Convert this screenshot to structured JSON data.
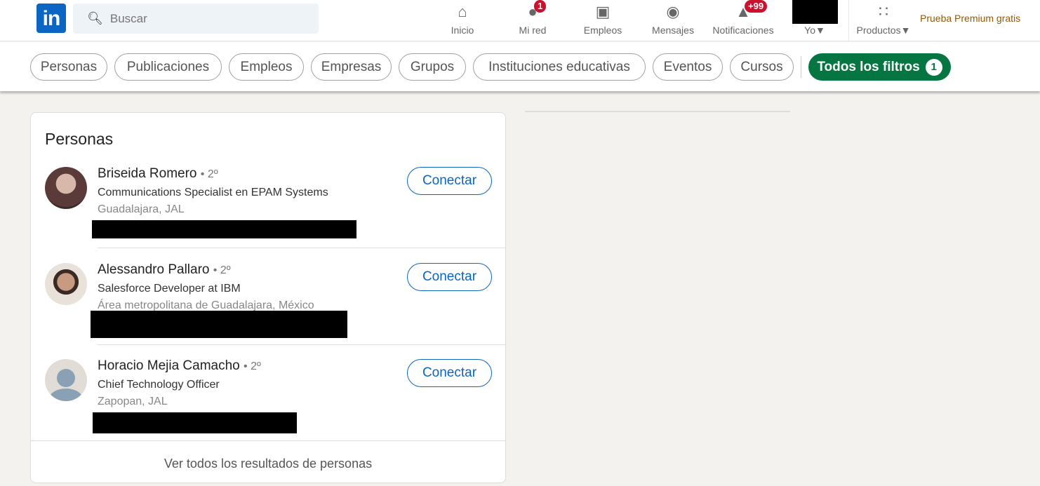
{
  "nav": {
    "logo": "in",
    "search_placeholder": "Buscar",
    "items": [
      {
        "label": "Inicio",
        "icon": "home-icon"
      },
      {
        "label": "Mi red",
        "icon": "network-icon",
        "badge": "1"
      },
      {
        "label": "Empleos",
        "icon": "briefcase-icon"
      },
      {
        "label": "Mensajes",
        "icon": "messaging-icon"
      },
      {
        "label": "Notificaciones",
        "icon": "bell-icon",
        "badge": "+99"
      },
      {
        "label": "Yo"
      },
      {
        "label": "Productos",
        "icon": "grid-icon"
      }
    ],
    "premium": "Prueba Premium gratis"
  },
  "filters": {
    "pills": [
      "Personas",
      "Publicaciones",
      "Empleos",
      "Empresas",
      "Grupos",
      "Instituciones educativas",
      "Eventos",
      "Cursos"
    ],
    "all_filters": "Todos los filtros",
    "all_filters_count": "1"
  },
  "people": {
    "title": "Personas",
    "connect_label": "Conectar",
    "degree": "• 2º",
    "results": [
      {
        "name": "Briseida Romero",
        "headline": "Communications Specialist en EPAM Systems",
        "location": "Guadalajara, JAL"
      },
      {
        "name": "Alessandro Pallaro",
        "headline": "Salesforce Developer at IBM",
        "location": "Área metropolitana de Guadalajara, México"
      },
      {
        "name": "Horacio Mejia Camacho",
        "headline": "Chief Technology Officer",
        "location": "Zapopan, JAL"
      }
    ],
    "see_all": "Ver todos los resultados de personas"
  }
}
